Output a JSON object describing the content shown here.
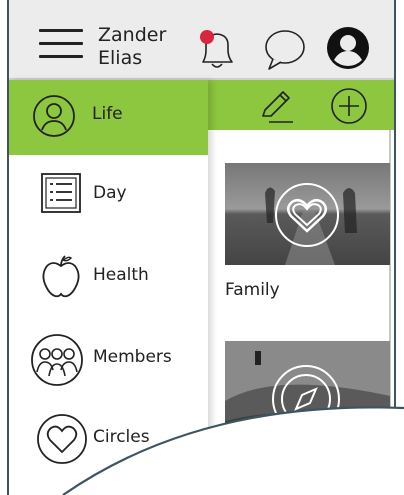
{
  "header": {
    "user_first": "Zander",
    "user_last": "Elias",
    "icons": [
      "menu-icon",
      "bell-icon",
      "chat-icon",
      "account-icon"
    ],
    "notification_color": "#d7263d"
  },
  "toolbar": {
    "icons": [
      "edit-icon",
      "add-icon"
    ],
    "accent": "#8dc63f"
  },
  "sidebar": {
    "items": [
      {
        "label": "Life",
        "icon": "person-icon",
        "active": true
      },
      {
        "label": "Day",
        "icon": "list-icon",
        "active": false
      },
      {
        "label": "Health",
        "icon": "apple-icon",
        "active": false
      },
      {
        "label": "Members",
        "icon": "group-icon",
        "active": false
      },
      {
        "label": "Circles",
        "icon": "heart-icon",
        "active": false
      }
    ]
  },
  "cards": [
    {
      "label": "Family",
      "icon": "heart-icon"
    },
    {
      "label": "",
      "icon": "compass-icon"
    }
  ]
}
